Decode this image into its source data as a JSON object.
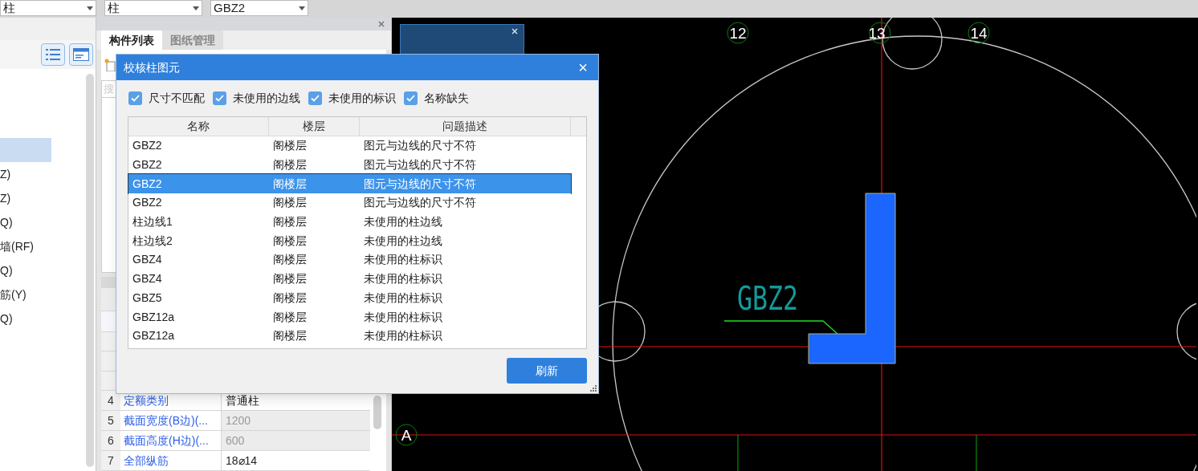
{
  "toolbar": {
    "dropdowns": [
      {
        "value": "柱"
      },
      {
        "value": "柱"
      },
      {
        "value": "GBZ2"
      }
    ]
  },
  "tree": {
    "items": [
      {
        "selected": true
      },
      {
        "label": "Z)",
        "selected": false
      },
      {
        "label": "Z)",
        "selected": false
      },
      {
        "label": "Q)",
        "selected": false
      },
      {
        "label": "墙(RF)",
        "selected": false
      },
      {
        "label": "Q)",
        "selected": false
      },
      {
        "label": "筋(Y)",
        "selected": false
      },
      {
        "label": "Q)",
        "selected": false
      }
    ]
  },
  "component_panel": {
    "tabs": [
      {
        "label": "构件列表",
        "selected": true
      },
      {
        "label": "图纸管理",
        "selected": false
      }
    ],
    "search": {
      "placeholder": "搜"
    }
  },
  "properties": {
    "rows": [
      {
        "number": "4",
        "name": "定额类别",
        "value": "普通柱",
        "disabled": false
      },
      {
        "number": "5",
        "name": "截面宽度(B边)(...",
        "value": "1200",
        "disabled": true
      },
      {
        "number": "6",
        "name": "截面高度(H边)(...",
        "value": "600",
        "disabled": true
      },
      {
        "number": "7",
        "name": "全部纵筋",
        "value": "18⌀14",
        "disabled": false
      }
    ]
  },
  "check_dialog": {
    "title": "校核柱图元",
    "close": "×",
    "filters": [
      {
        "label": "尺寸不匹配",
        "checked": true
      },
      {
        "label": "未使用的边线",
        "checked": true
      },
      {
        "label": "未使用的标识",
        "checked": true
      },
      {
        "label": "名称缺失",
        "checked": true
      }
    ],
    "columns": [
      "名称",
      "楼层",
      "问题描述"
    ],
    "rows": [
      {
        "name": "GBZ2",
        "floor": "阁楼层",
        "description": "图元与边线的尺寸不符",
        "selected": false
      },
      {
        "name": "GBZ2",
        "floor": "阁楼层",
        "description": "图元与边线的尺寸不符",
        "selected": false
      },
      {
        "name": "GBZ2",
        "floor": "阁楼层",
        "description": "图元与边线的尺寸不符",
        "selected": true
      },
      {
        "name": "GBZ2",
        "floor": "阁楼层",
        "description": "图元与边线的尺寸不符",
        "selected": false
      },
      {
        "name": "柱边线1",
        "floor": "阁楼层",
        "description": "未使用的柱边线",
        "selected": false
      },
      {
        "name": "柱边线2",
        "floor": "阁楼层",
        "description": "未使用的柱边线",
        "selected": false
      },
      {
        "name": "GBZ4",
        "floor": "阁楼层",
        "description": "未使用的柱标识",
        "selected": false
      },
      {
        "name": "GBZ4",
        "floor": "阁楼层",
        "description": "未使用的柱标识",
        "selected": false
      },
      {
        "name": "GBZ5",
        "floor": "阁楼层",
        "description": "未使用的柱标识",
        "selected": false
      },
      {
        "name": "GBZ12a",
        "floor": "阁楼层",
        "description": "未使用的柱标识",
        "selected": false
      },
      {
        "name": "GBZ12a",
        "floor": "阁楼层",
        "description": "未使用的柱标识",
        "selected": false
      }
    ],
    "refresh_button": "刷新"
  },
  "drawing": {
    "axis_labels": [
      {
        "text": "12"
      },
      {
        "text": "13"
      },
      {
        "text": "14"
      },
      {
        "text": "A"
      }
    ],
    "column_label": "GBZ2"
  }
}
